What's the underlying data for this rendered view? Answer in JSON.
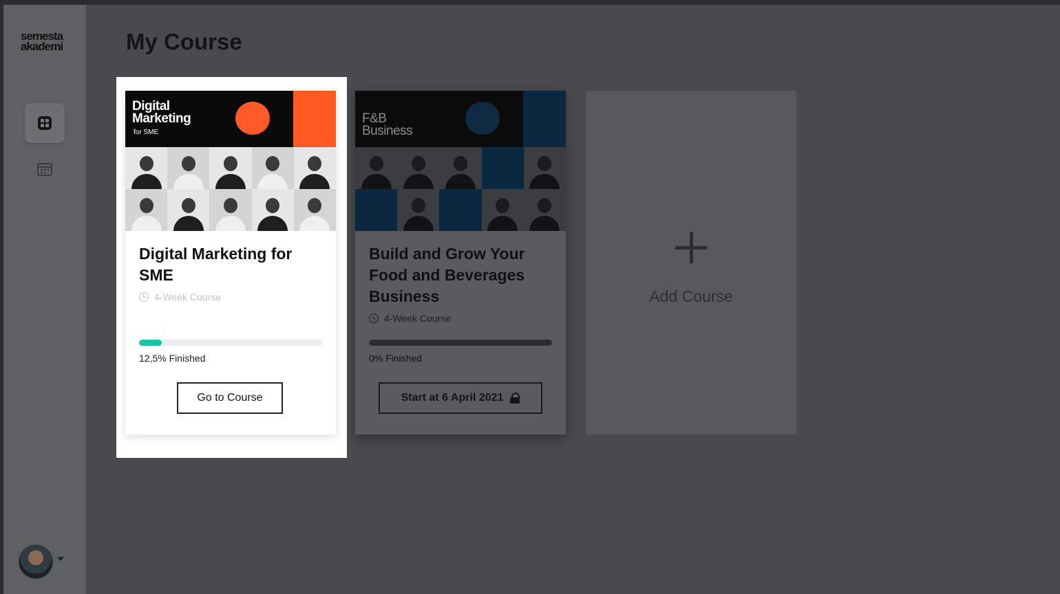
{
  "app": {
    "logo_line1": "semesta",
    "logo_line2": "akademi"
  },
  "sidebar": {
    "items": [
      {
        "name": "dashboard",
        "icon": "grid-icon",
        "active": true
      },
      {
        "name": "calendar",
        "icon": "calendar-icon",
        "active": false
      }
    ],
    "user": {
      "icon": "avatar"
    }
  },
  "page": {
    "title": "My Course"
  },
  "courses": [
    {
      "banner_title_line1": "Digital",
      "banner_title_line2": "Marketing",
      "banner_sub": "for SME",
      "title_line1": "Digital Marketing for",
      "title_line2": "SME",
      "title_line3": "",
      "duration": "4-Week Course",
      "progress": 0.125,
      "progress_text": "12,5% Finished",
      "button_label": "Go to Course",
      "locked": false
    },
    {
      "banner_title_line1": "F&B",
      "banner_title_line2": "Business",
      "title_line1": "Build and Grow Your",
      "title_line2": "Food and Beverages",
      "title_line3": "Business",
      "duration": "4-Week Course",
      "progress": 0,
      "progress_text": "0% Finished",
      "button_label": "Start at 6 April 2021",
      "locked": true
    }
  ],
  "add_course": {
    "label": "Add Course",
    "icon": "plus-icon"
  },
  "colors": {
    "accent": "#19c3a9",
    "brand_orange": "#ff5a22",
    "overlay": "#484a4d"
  }
}
